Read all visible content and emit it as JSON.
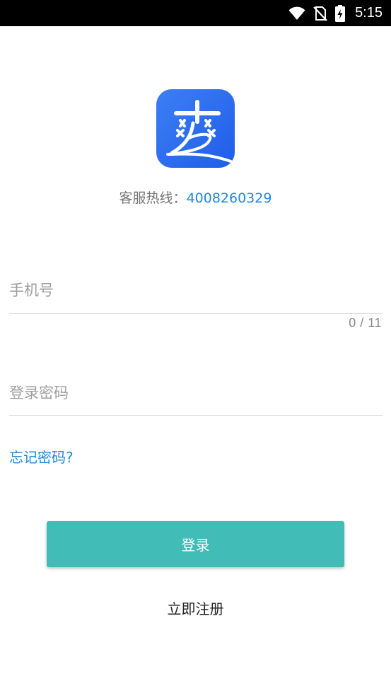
{
  "status_bar": {
    "time": "5:15",
    "icons": [
      "wifi-icon",
      "no-sim-icon",
      "battery-charging-icon"
    ]
  },
  "logo": {
    "glyph": "爽",
    "background": "#2f6ef0"
  },
  "hotline": {
    "label": "客服热线：",
    "number": "4008260329"
  },
  "phone": {
    "placeholder": "手机号",
    "value": "",
    "counter": "0 / 11"
  },
  "password": {
    "placeholder": "登录密码",
    "value": ""
  },
  "links": {
    "forgot": "忘记密码?",
    "register": "立即注册"
  },
  "login": {
    "label": "登录",
    "color": "#41bcb7"
  },
  "colors": {
    "accent": "#1e88d8",
    "primary_button": "#41bcb7",
    "status_bar": "#000000"
  }
}
